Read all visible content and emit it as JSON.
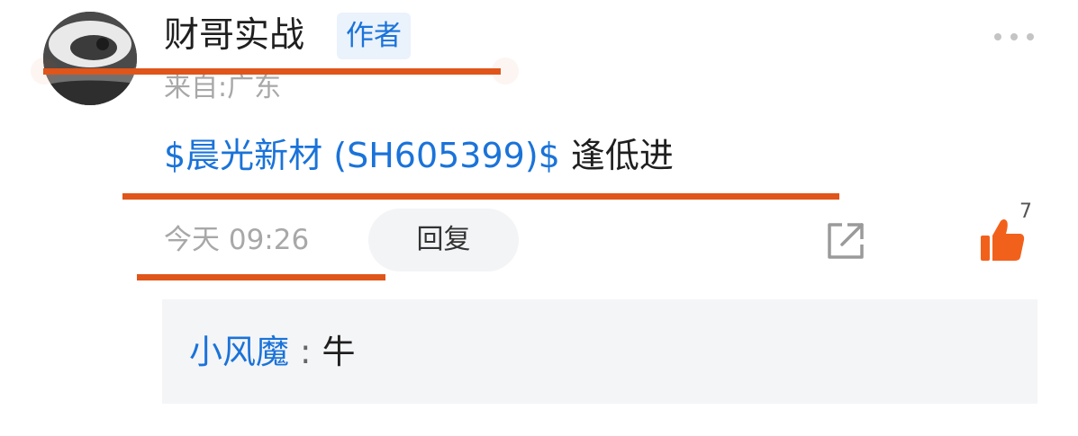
{
  "comment": {
    "author": {
      "name": "财哥实战",
      "badge": "作者",
      "location": "来自:广东"
    },
    "post": {
      "stock_link": "$晨光新材 (SH605399)$",
      "text": " 逢低进"
    },
    "meta": {
      "time": "今天 09:26",
      "reply_label": "回复",
      "like_count": "7"
    },
    "reply": {
      "user": "小风魔",
      "separator": ":",
      "text": "牛"
    }
  },
  "icons": {
    "more": "more-dots-icon",
    "share": "share-icon",
    "like": "thumbs-up-icon"
  },
  "colors": {
    "link_blue": "#1a73d9",
    "like_orange": "#f2611b",
    "annotation_orange": "#e0551a",
    "muted_gray": "#a8a8a8",
    "reply_bg": "#f4f5f7"
  }
}
